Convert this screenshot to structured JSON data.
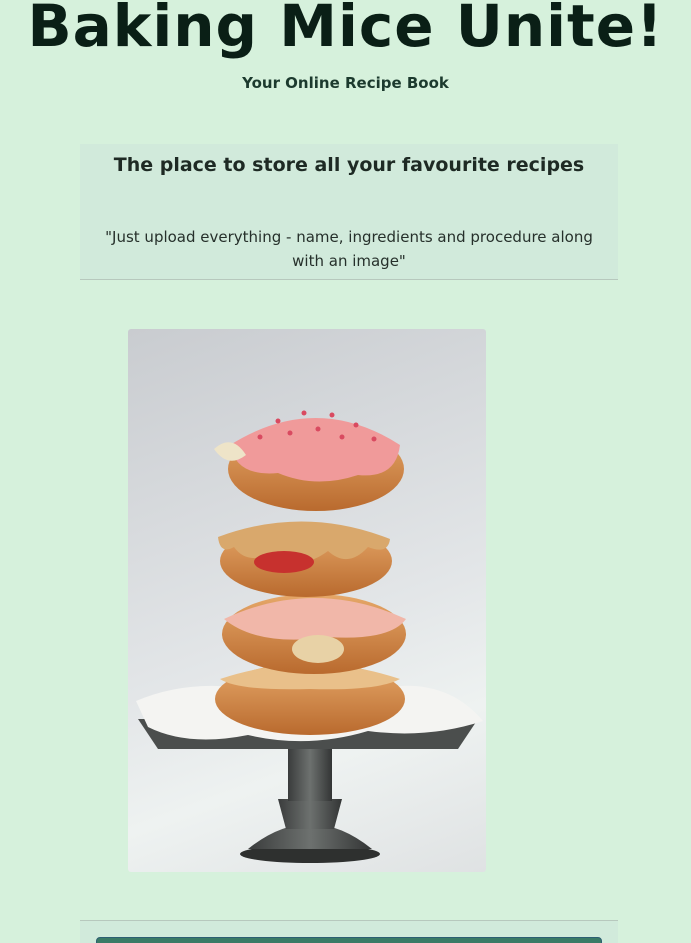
{
  "header": {
    "title": "Baking Mice Unite!",
    "subtitle": "Your Online Recipe Book"
  },
  "intro": {
    "heading": "The place to store all your favourite recipes",
    "quote": "\"Just upload everything - name, ingredients and procedure along with an image\""
  },
  "hero": {
    "image": "stack-of-doughnuts-on-cake-stand"
  },
  "footer": {
    "button_label": ""
  },
  "colors": {
    "background": "#d6f1dc",
    "card": "#d1eadb",
    "title": "#0a1f16",
    "button": "#3a7a66"
  }
}
